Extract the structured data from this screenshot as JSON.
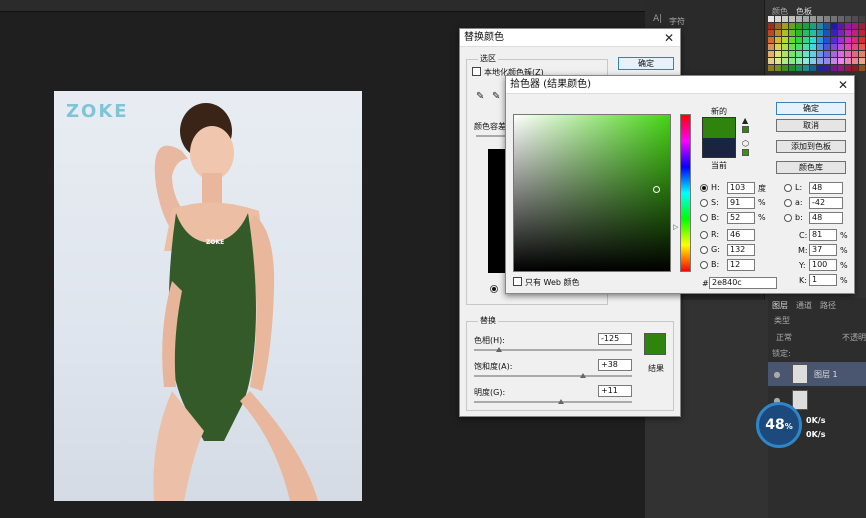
{
  "replace_color": {
    "title": "替换颜色",
    "selection_group": "选区",
    "localized_clusters": "本地化颜色簇(Z)",
    "fuzziness_label": "颜色容差",
    "ok": "确定",
    "replace_group": "替换",
    "hue_label": "色相(H):",
    "hue_value": "-125",
    "saturation_label": "饱和度(A):",
    "saturation_value": "+38",
    "lightness_label": "明度(G):",
    "lightness_value": "+11",
    "result_label": "结果",
    "result_color": "#2e840c"
  },
  "color_picker": {
    "title": "拾色器 (结果颜色)",
    "new_label": "新的",
    "current_label": "当前",
    "new_color": "#2e840c",
    "current_color": "#1a2440",
    "ok": "确定",
    "cancel": "取消",
    "add_to_swatches": "添加到色板",
    "color_libraries": "颜色库",
    "web_only": "只有 Web 颜色",
    "H": "103",
    "H_unit": "度",
    "S": "91",
    "S_unit": "%",
    "Bv": "52",
    "B_unit": "%",
    "R": "46",
    "G": "132",
    "B": "12",
    "L": "48",
    "a": "-42",
    "b": "48",
    "C": "81",
    "M": "37",
    "Y": "100",
    "K": "1",
    "hex": "2e840c",
    "hex_prefix": "#",
    "labels": {
      "H": "H:",
      "S": "S:",
      "Bv": "B:",
      "R": "R:",
      "G": "G:",
      "B": "B:",
      "L": "L:",
      "a": "a:",
      "b": "b:",
      "C": "C:",
      "M": "M:",
      "Y": "Y:",
      "K": "K:",
      "pct": "%"
    }
  },
  "panels": {
    "tab_color": "颜色",
    "tab_swatches": "色板",
    "char_label": "字符",
    "tab_layers": "图层",
    "tab_channels": "通道",
    "tab_paths": "路径",
    "kind_label": "类型",
    "blend_mode": "正常",
    "opacity_label": "不透明",
    "lock_label": "锁定:",
    "layer1_name": "图层 1"
  },
  "photo": {
    "brand_logo": "ZOKE",
    "suit_logo": "ZOKE"
  },
  "speed_widget": {
    "percent": "48",
    "percent_sign": "%",
    "up": "0K/s",
    "down": "0K/s"
  }
}
